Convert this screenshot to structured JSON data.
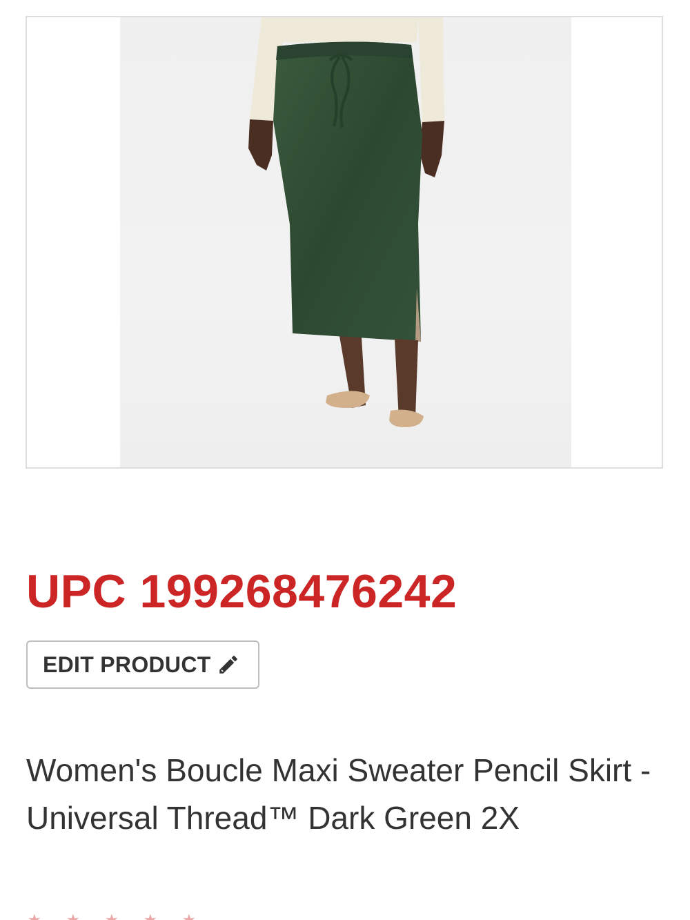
{
  "product": {
    "upc_text": "UPC 199268476242",
    "edit_button_label": "EDIT PRODUCT",
    "title": "Women's Boucle Maxi Sweater Pencil Skirt - Universal Thread™ Dark Green 2X"
  },
  "icons": {
    "edit": "pencil-icon",
    "rating": "star-icon"
  },
  "colors": {
    "accent_red": "#cc2525",
    "text_dark": "#333333",
    "button_border": "#bdbdbd",
    "skirt_green": "#2f4a33"
  }
}
